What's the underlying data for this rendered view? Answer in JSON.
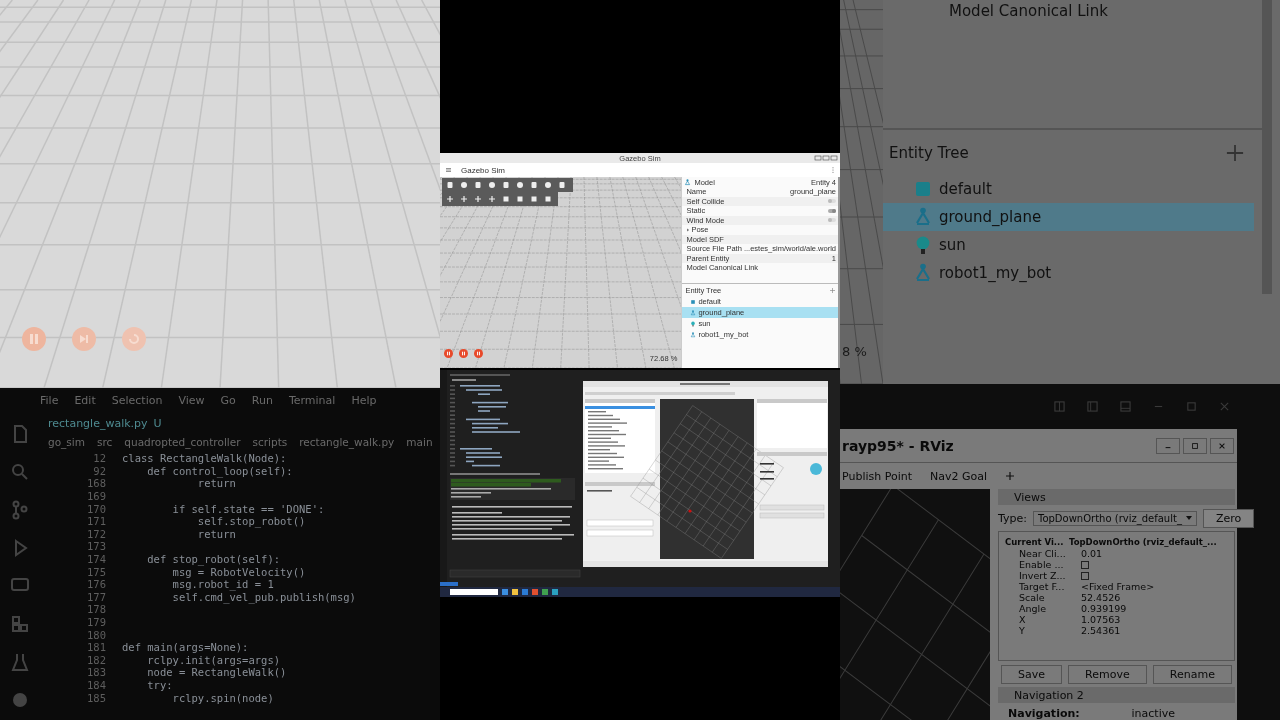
{
  "left_editor": {
    "menu": [
      "File",
      "Edit",
      "Selection",
      "View",
      "Go",
      "Run",
      "Terminal",
      "Help"
    ],
    "tab": {
      "label": "rectangle_walk.py",
      "status": "U"
    },
    "breadcrumb": [
      "go_sim",
      "src",
      "quadropted_controller",
      "scripts",
      "rectangle_walk.py",
      "main"
    ],
    "lines": [
      {
        "number": "12",
        "code": "class RectangleWalk(Node):"
      },
      {
        "number": "92",
        "code": "    def control_loop(self):"
      },
      {
        "number": "168",
        "code": "            return"
      },
      {
        "number": "169"
      },
      {
        "number": "170",
        "code": "        if self.state == 'DONE':"
      },
      {
        "number": "171",
        "code": "            self.stop_robot()"
      },
      {
        "number": "172",
        "code": "            return"
      },
      {
        "number": "173"
      },
      {
        "number": "174",
        "code": "    def stop_robot(self):"
      },
      {
        "number": "175",
        "code": "        msg = RobotVelocity()"
      },
      {
        "number": "176",
        "code": "        msg.robot_id = 1"
      },
      {
        "number": "177",
        "code": "        self.cmd_vel_pub.publish(msg)"
      },
      {
        "number": "178"
      },
      {
        "number": "179"
      },
      {
        "number": "180"
      },
      {
        "number": "181",
        "code": "def main(args=None):"
      },
      {
        "number": "182",
        "code": "    rclpy.init(args=args)"
      },
      {
        "number": "183",
        "code": "    node = RectangleWalk()"
      },
      {
        "number": "184",
        "code": "    try:"
      },
      {
        "number": "185",
        "code": "        rclpy.spin(node)"
      }
    ]
  },
  "gazebo": {
    "window_title": "Gazebo Sim",
    "app_title": "Gazebo Sim",
    "zoom": "72.68 %",
    "component": {
      "title": "Model",
      "entity": "Entity 4",
      "rows": [
        {
          "kind": "text",
          "name": "Name",
          "value": "ground_plane"
        },
        {
          "kind": "toggle",
          "name": "Self Collide",
          "on": false
        },
        {
          "kind": "toggle",
          "name": "Static",
          "on": true
        },
        {
          "kind": "toggle",
          "name": "Wind Mode",
          "on": false
        },
        {
          "kind": "group",
          "name": "Pose"
        },
        {
          "kind": "text",
          "name": "Model SDF"
        },
        {
          "kind": "text",
          "name": "Source File Path",
          "value": "...estes_sim/world/ale.world"
        },
        {
          "kind": "text",
          "name": "Parent Entity",
          "value": "1"
        },
        {
          "kind": "text",
          "name": "Model Canonical Link"
        }
      ]
    },
    "entity_tree": {
      "title": "Entity Tree",
      "items": [
        {
          "label": "default",
          "kind": "world",
          "selected": false
        },
        {
          "label": "ground_plane",
          "kind": "model",
          "selected": true
        },
        {
          "label": "sun",
          "kind": "light",
          "selected": false
        },
        {
          "label": "robot1_my_bot",
          "kind": "model",
          "selected": false
        }
      ]
    }
  },
  "right_panel": {
    "property": "Model Canonical Link",
    "zoom_fragment": "8 %",
    "entity_tree": {
      "title": "Entity Tree",
      "items": [
        {
          "label": "default",
          "kind": "world",
          "selected": false
        },
        {
          "label": "ground_plane",
          "kind": "model",
          "selected": true
        },
        {
          "label": "sun",
          "kind": "light",
          "selected": false
        },
        {
          "label": "robot1_my_bot",
          "kind": "model",
          "selected": false
        }
      ]
    }
  },
  "right_rviz": {
    "title": "rayp95* - RViz",
    "tools": [
      "Publish Point",
      "Nav2 Goal"
    ],
    "views": {
      "title": "Views",
      "type_label": "Type:",
      "type_value": "TopDownOrtho (rviz_default_",
      "zero": "Zero",
      "rows": [
        {
          "kind": "text",
          "name": "Current Vi...",
          "value": "TopDownOrtho (rviz_default_..."
        },
        {
          "kind": "text",
          "name": "Near Cli...",
          "value": "0.01"
        },
        {
          "kind": "check",
          "name": "Enable ...",
          "checked": false
        },
        {
          "kind": "check",
          "name": "Invert Z...",
          "checked": false
        },
        {
          "kind": "text",
          "name": "Target F...",
          "value": "<Fixed Frame>"
        },
        {
          "kind": "text",
          "name": "Scale",
          "value": "52.4526"
        },
        {
          "kind": "text",
          "name": "Angle",
          "value": "0.939199"
        },
        {
          "kind": "text",
          "name": "X",
          "value": "1.07563"
        },
        {
          "kind": "text",
          "name": "Y",
          "value": "2.54361"
        }
      ],
      "buttons": [
        "Save",
        "Remove",
        "Rename"
      ]
    },
    "navigation": {
      "title": "Navigation 2",
      "label": "Navigation:",
      "value": "inactive"
    }
  }
}
